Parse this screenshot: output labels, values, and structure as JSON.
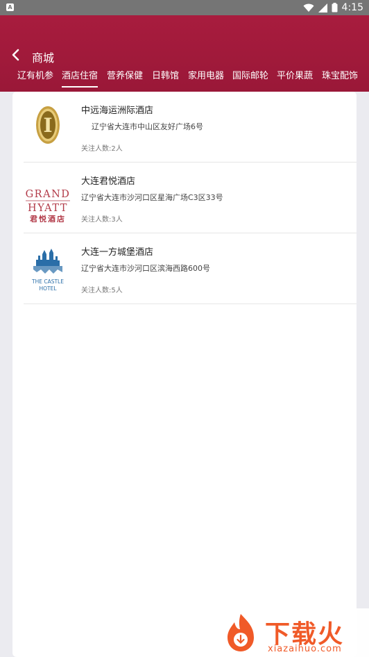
{
  "status_bar": {
    "time": "4:15"
  },
  "header": {
    "title": "商城"
  },
  "tabs": [
    {
      "label": "辽有机参"
    },
    {
      "label": "酒店住宿"
    },
    {
      "label": "营养保健"
    },
    {
      "label": "日韩馆"
    },
    {
      "label": "家用电器"
    },
    {
      "label": "国际邮轮"
    },
    {
      "label": "平价果蔬"
    },
    {
      "label": "珠宝配饰"
    }
  ],
  "active_tab": "酒店住宿",
  "hotels": [
    {
      "name": "中远海运洲际酒店",
      "address": "辽宁省大连市中山区友好广场6号",
      "followers": "关注人数:2人",
      "logo": {
        "icon": "intercontinental-logo",
        "text": "I"
      }
    },
    {
      "name": "大连君悦酒店",
      "address": "辽宁省大连市沙河口区星海广场C3区33号",
      "followers": "关注人数:3人",
      "logo": {
        "icon": "grand-hyatt-logo",
        "line1": "GRAND",
        "line2": "HYATT",
        "line3": "君悦酒店"
      }
    },
    {
      "name": "大连一方城堡酒店",
      "address": "辽宁省大连市沙河口区滨海西路600号",
      "followers": "关注人数:5人",
      "logo": {
        "icon": "castle-hotel-logo",
        "line1": "THE CASTLE",
        "line2": "HOTEL"
      }
    }
  ],
  "watermark": {
    "text": "下载火",
    "sub": "xiazaihuo.com"
  },
  "colors": {
    "brand": "#a81c3e",
    "watermark": "#f05a28"
  }
}
